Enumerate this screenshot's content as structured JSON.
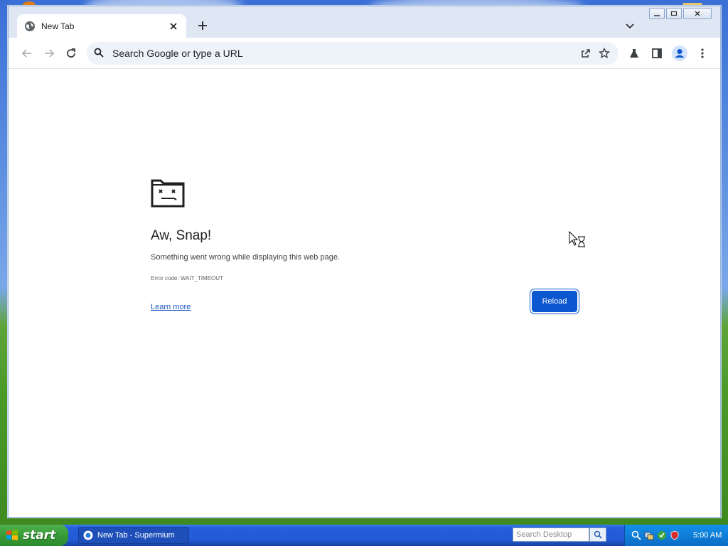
{
  "browser": {
    "tab": {
      "title": "New Tab"
    },
    "omnibox": {
      "placeholder": "Search Google or type a URL"
    }
  },
  "error_page": {
    "title": "Aw, Snap!",
    "message": "Something went wrong while displaying this web page.",
    "error_code": "Error code: WAIT_TIMEOUT",
    "learn_more": "Learn more",
    "reload": "Reload"
  },
  "taskbar": {
    "start_label": "start",
    "task_item": "New Tab - Supermium",
    "search_placeholder": "Search Desktop",
    "clock": "5:00 AM"
  },
  "colors": {
    "accent": "#0b57d0",
    "link": "#1a56c4",
    "taskbar": "#245edb",
    "start_button": "#379b37"
  }
}
